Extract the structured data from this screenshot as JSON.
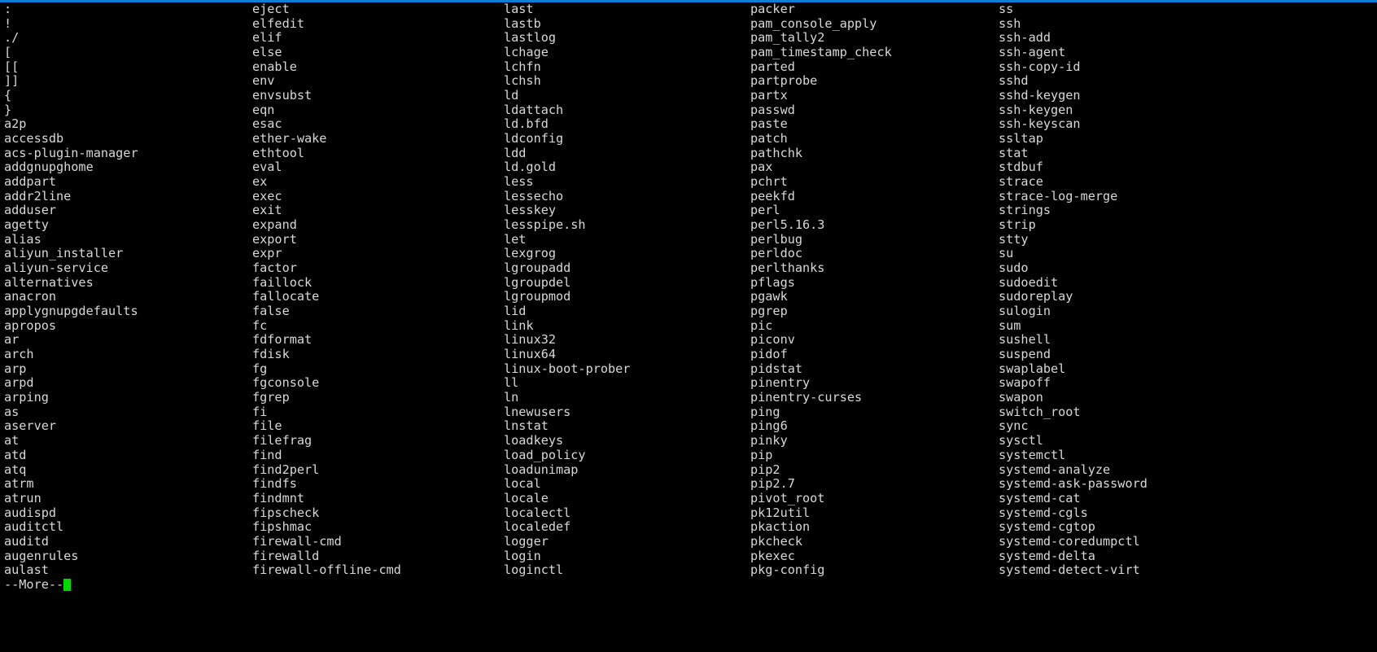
{
  "terminal": {
    "colors": {
      "background": "#000000",
      "foreground": "#d8d8d8",
      "top_border": "#0b7fd4",
      "cursor": "#00d900"
    },
    "pager_prompt": "--More--",
    "columns": [
      {
        "name": "column-1",
        "items": [
          ":",
          "!",
          "./",
          "[",
          "[[",
          "]]",
          "{",
          "}",
          "a2p",
          "accessdb",
          "acs-plugin-manager",
          "addgnupghome",
          "addpart",
          "addr2line",
          "adduser",
          "agetty",
          "alias",
          "aliyun_installer",
          "aliyun-service",
          "alternatives",
          "anacron",
          "applygnupgdefaults",
          "apropos",
          "ar",
          "arch",
          "arp",
          "arpd",
          "arping",
          "as",
          "aserver",
          "at",
          "atd",
          "atq",
          "atrm",
          "atrun",
          "audispd",
          "auditctl",
          "auditd",
          "augenrules",
          "aulast"
        ]
      },
      {
        "name": "column-2",
        "items": [
          "eject",
          "elfedit",
          "elif",
          "else",
          "enable",
          "env",
          "envsubst",
          "eqn",
          "esac",
          "ether-wake",
          "ethtool",
          "eval",
          "ex",
          "exec",
          "exit",
          "expand",
          "export",
          "expr",
          "factor",
          "faillock",
          "fallocate",
          "false",
          "fc",
          "fdformat",
          "fdisk",
          "fg",
          "fgconsole",
          "fgrep",
          "fi",
          "file",
          "filefrag",
          "find",
          "find2perl",
          "findfs",
          "findmnt",
          "fipscheck",
          "fipshmac",
          "firewall-cmd",
          "firewalld",
          "firewall-offline-cmd"
        ]
      },
      {
        "name": "column-3",
        "items": [
          "last",
          "lastb",
          "lastlog",
          "lchage",
          "lchfn",
          "lchsh",
          "ld",
          "ldattach",
          "ld.bfd",
          "ldconfig",
          "ldd",
          "ld.gold",
          "less",
          "lessecho",
          "lesskey",
          "lesspipe.sh",
          "let",
          "lexgrog",
          "lgroupadd",
          "lgroupdel",
          "lgroupmod",
          "lid",
          "link",
          "linux32",
          "linux64",
          "linux-boot-prober",
          "ll",
          "ln",
          "lnewusers",
          "lnstat",
          "loadkeys",
          "load_policy",
          "loadunimap",
          "local",
          "locale",
          "localectl",
          "localedef",
          "logger",
          "login",
          "loginctl"
        ]
      },
      {
        "name": "column-4",
        "items": [
          "packer",
          "pam_console_apply",
          "pam_tally2",
          "pam_timestamp_check",
          "parted",
          "partprobe",
          "partx",
          "passwd",
          "paste",
          "patch",
          "pathchk",
          "pax",
          "pchrt",
          "peekfd",
          "perl",
          "perl5.16.3",
          "perlbug",
          "perldoc",
          "perlthanks",
          "pflags",
          "pgawk",
          "pgrep",
          "pic",
          "piconv",
          "pidof",
          "pidstat",
          "pinentry",
          "pinentry-curses",
          "ping",
          "ping6",
          "pinky",
          "pip",
          "pip2",
          "pip2.7",
          "pivot_root",
          "pk12util",
          "pkaction",
          "pkcheck",
          "pkexec",
          "pkg-config"
        ]
      },
      {
        "name": "column-5",
        "items": [
          "ss",
          "ssh",
          "ssh-add",
          "ssh-agent",
          "ssh-copy-id",
          "sshd",
          "sshd-keygen",
          "ssh-keygen",
          "ssh-keyscan",
          "ssltap",
          "stat",
          "stdbuf",
          "strace",
          "strace-log-merge",
          "strings",
          "strip",
          "stty",
          "su",
          "sudo",
          "sudoedit",
          "sudoreplay",
          "sulogin",
          "sum",
          "sushell",
          "suspend",
          "swaplabel",
          "swapoff",
          "swapon",
          "switch_root",
          "sync",
          "sysctl",
          "systemctl",
          "systemd-analyze",
          "systemd-ask-password",
          "systemd-cat",
          "systemd-cgls",
          "systemd-cgtop",
          "systemd-coredumpctl",
          "systemd-delta",
          "systemd-detect-virt"
        ]
      }
    ]
  }
}
